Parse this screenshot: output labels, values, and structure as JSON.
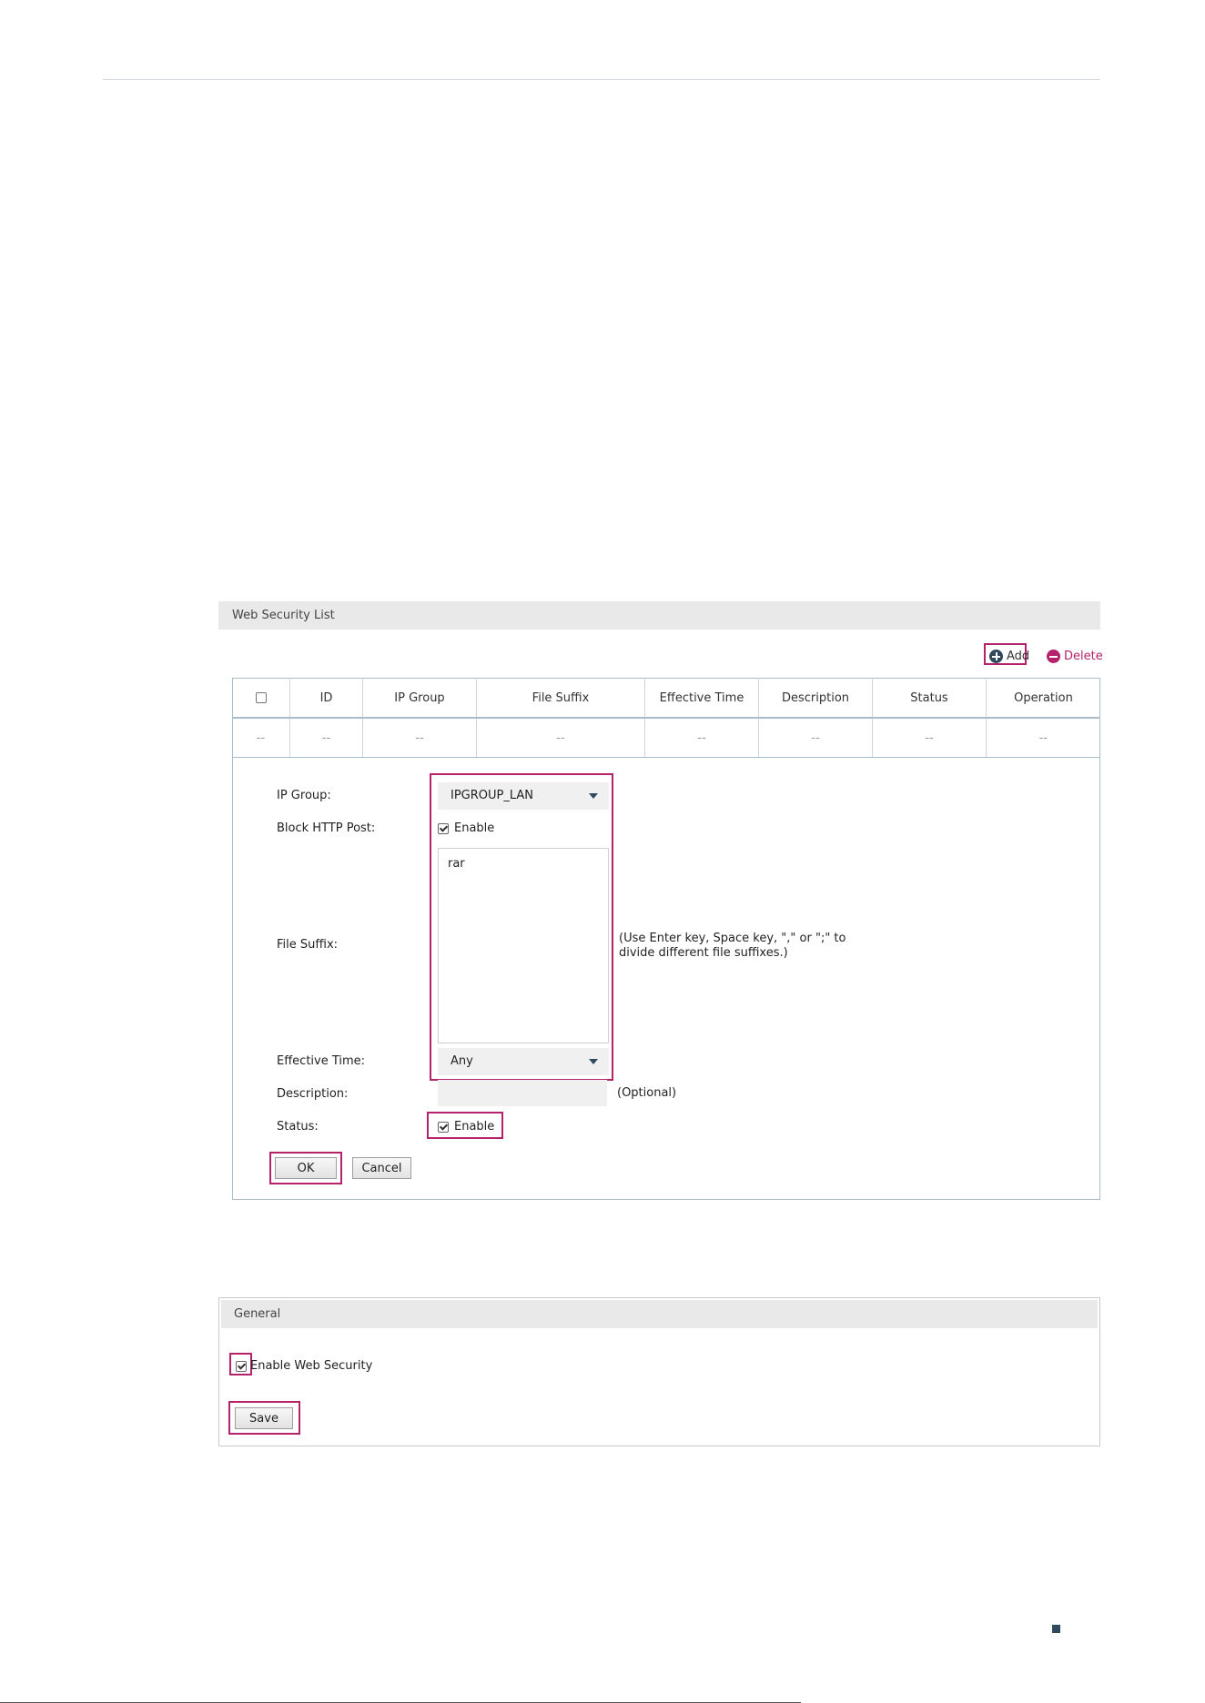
{
  "list_panel": {
    "title": "Web Security List",
    "add_label": "Add",
    "delete_label": "Delete",
    "columns": [
      "ID",
      "IP Group",
      "File Suffix",
      "Effective Time",
      "Description",
      "Status",
      "Operation"
    ],
    "empty_row": [
      "--",
      "--",
      "--",
      "--",
      "--",
      "--",
      "--",
      "--"
    ]
  },
  "form": {
    "ip_group_label": "IP Group:",
    "ip_group_value": "IPGROUP_LAN",
    "block_http_label": "Block HTTP Post:",
    "block_http_checked_label": "Enable",
    "file_suffix_label": "File Suffix:",
    "file_suffix_value": "rar",
    "file_suffix_hint_line1": "(Use Enter key, Space key, \",\" or \";\" to",
    "file_suffix_hint_line2": "divide different file suffixes.)",
    "effective_time_label": "Effective Time:",
    "effective_time_value": "Any",
    "description_label": "Description:",
    "description_value": "",
    "description_hint": "(Optional)",
    "status_label": "Status:",
    "status_checked_label": "Enable",
    "ok_label": "OK",
    "cancel_label": "Cancel"
  },
  "general_panel": {
    "title": "General",
    "enable_label": "Enable Web Security",
    "save_label": "Save"
  },
  "colors": {
    "highlight": "#b3226a",
    "header_bg": "#e9e9e9",
    "table_border": "#a9bccb"
  }
}
